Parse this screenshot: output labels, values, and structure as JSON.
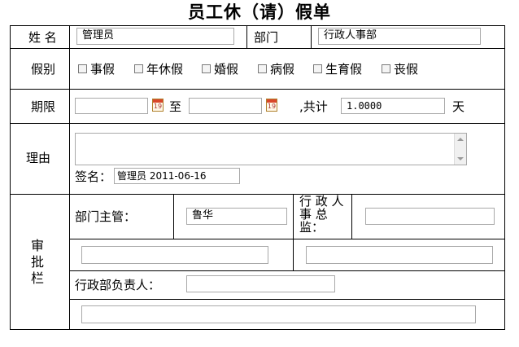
{
  "title": "员工休（请）假单",
  "labels": {
    "name": "姓 名",
    "department": "部门",
    "leave_type": "假别",
    "period": "期限",
    "to": "至",
    "total": ",共计",
    "days": "天",
    "reason": "理由",
    "signature": "签名：",
    "approval": "审批栏",
    "dept_manager": "部门主管：",
    "hr_director": "行 政 人 事 总监：",
    "admin_head": "行政部负责人："
  },
  "fields": {
    "name_value": "管理员",
    "department_value": "行政人事部",
    "start_date": "",
    "end_date": "",
    "total_days": "1.0000",
    "reason_text": "",
    "signature_value": "管理员 2011-06-16",
    "dept_manager_value": "鲁华",
    "hr_director_value": "",
    "dept_manager_comment": "",
    "hr_director_comment": "",
    "admin_head_value": "",
    "admin_head_comment": ""
  },
  "leave_types": [
    "事假",
    "年休假",
    "婚假",
    "病假",
    "生育假",
    "丧假"
  ],
  "calendar_icon_text": "19"
}
